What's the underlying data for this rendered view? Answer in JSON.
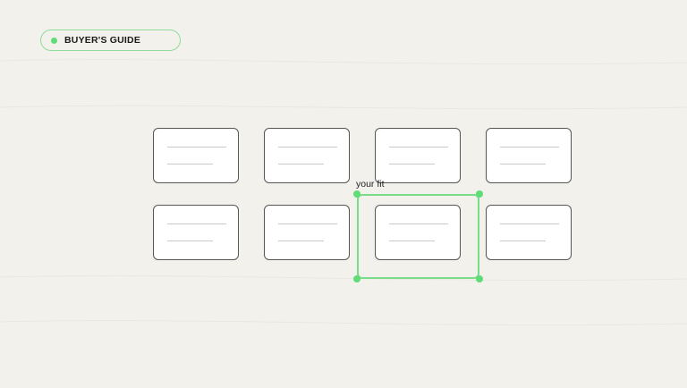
{
  "badge": {
    "label": "BUYER'S GUIDE"
  },
  "cards": [
    {
      "row": 1,
      "col": 1
    },
    {
      "row": 1,
      "col": 2
    },
    {
      "row": 1,
      "col": 3
    },
    {
      "row": 1,
      "col": 4
    },
    {
      "row": 2,
      "col": 1
    },
    {
      "row": 2,
      "col": 2
    },
    {
      "row": 2,
      "col": 3,
      "selected": true
    },
    {
      "row": 2,
      "col": 4
    }
  ],
  "selection": {
    "label": "your fit"
  },
  "colors": {
    "background": "#f2f1ec",
    "accent": "#5fdc78",
    "card_border": "#555553",
    "card_fill": "#ffffff"
  }
}
